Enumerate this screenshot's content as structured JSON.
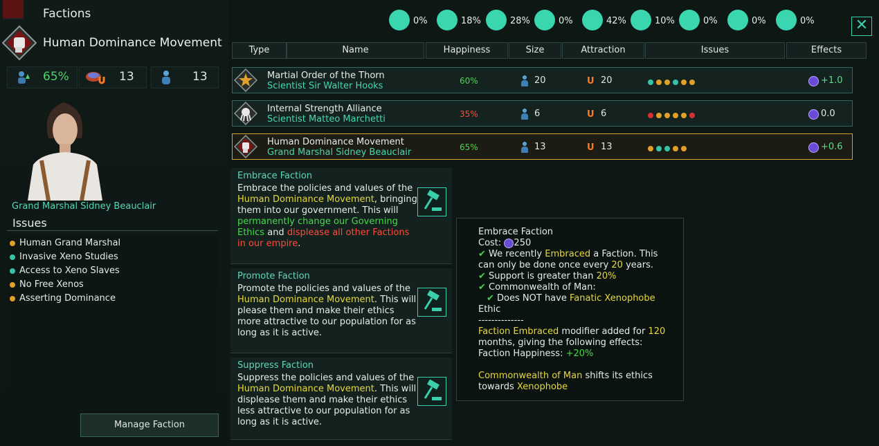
{
  "window": {
    "title": "Factions",
    "close_glyph": "✕"
  },
  "faction": {
    "name": "Human Dominance Movement",
    "happiness": "65%",
    "support": "13",
    "pops": "13",
    "leader": "Grand Marshal Sidney Beauclair"
  },
  "issues": {
    "title": "Issues",
    "items": [
      {
        "label": "Human Grand Marshal",
        "color": "#e0a029"
      },
      {
        "label": "Invasive Xeno Studies",
        "color": "#39c3a6"
      },
      {
        "label": "Access to Xeno Slaves",
        "color": "#39c3a6"
      },
      {
        "label": "No Free Xenos",
        "color": "#e0a029"
      },
      {
        "label": "Asserting Dominance",
        "color": "#e0a029"
      }
    ]
  },
  "manage_button": "Manage Faction",
  "ethics_stats": [
    {
      "icon": "ethic-xenophobe-icon",
      "pct": "0%"
    },
    {
      "icon": "ethic-egalitarian-icon",
      "pct": "18%"
    },
    {
      "icon": "ethic-materialist-icon",
      "pct": "28%"
    },
    {
      "icon": "ethic-spiritualist-icon",
      "pct": "0%"
    },
    {
      "icon": "ethic-militarist-icon",
      "pct": "42%"
    },
    {
      "icon": "ethic-pacifist-icon",
      "pct": "10%"
    },
    {
      "icon": "ethic-authoritarian-icon",
      "pct": "0%"
    },
    {
      "icon": "ethic-xenophile-icon",
      "pct": "0%"
    },
    {
      "icon": "ethic-gestalt-icon",
      "pct": "0%"
    }
  ],
  "table": {
    "headers": [
      "Type",
      "Name",
      "Happiness",
      "Size",
      "Attraction",
      "Issues",
      "Effects"
    ],
    "rows": [
      {
        "name": "Martial Order of the Thorn",
        "leader": "Scientist Sir Walter Hooks",
        "happiness": "60%",
        "happy_color": "#49d849",
        "size": "20",
        "attraction": "20",
        "effect": "+1.0",
        "effect_color": "#57e08b",
        "dots": [
          "#39c3a6",
          "#e0a029",
          "#e0a029",
          "#39c3a6",
          "#e0a029",
          "#e0a029"
        ]
      },
      {
        "name": "Internal Strength Alliance",
        "leader": "Scientist Matteo Marchetti",
        "happiness": "35%",
        "happy_color": "#ff4a3a",
        "size": "6",
        "attraction": "6",
        "effect": "0.0",
        "effect_color": "#e2e9e6",
        "dots": [
          "#d83030",
          "#e0a029",
          "#e0a029",
          "#e0a029",
          "#e0a029",
          "#d83030"
        ]
      },
      {
        "name": "Human Dominance Movement",
        "leader": "Grand Marshal Sidney Beauclair",
        "happiness": "65%",
        "happy_color": "#49d849",
        "size": "13",
        "attraction": "13",
        "effect": "+0.6",
        "effect_color": "#57e08b",
        "dots": [
          "#e0a029",
          "#39c3a6",
          "#39c3a6",
          "#e0a029",
          "#e0a029"
        ]
      }
    ]
  },
  "actions": {
    "embrace": {
      "title": "Embrace Faction",
      "p1": "Embrace the policies and values of the ",
      "p2": "Human Dominance Movement",
      "p3": ", bringing them into our government. This will ",
      "p4": "permanently change our Governing Ethics",
      "p5": " and ",
      "p6": "displease all other Factions in our empire",
      "p7": "."
    },
    "promote": {
      "title": "Promote Faction",
      "p1": "Promote the policies and values of the ",
      "p2": "Human Dominance Movement",
      "p3": ". This will please them and make their ethics more attractive to our population for as long as it is active."
    },
    "suppress": {
      "title": "Suppress Faction",
      "p1": "Suppress the policies and values of the ",
      "p2": "Human Dominance Movement",
      "p3": ". This will displease them and make their ethics less attractive to our population for as long as it is active."
    }
  },
  "tooltip": {
    "title": "Embrace Faction",
    "cost_label": "Cost:",
    "cost_value": "250",
    "l1a": "We recently ",
    "l1b": "Embraced",
    "l1c": " a Faction. This",
    "l2a": "can only be done once every ",
    "l2b": "20",
    "l2c": " years.",
    "l3a": "Support is greater than ",
    "l3b": "20%",
    "l4": "Commonwealth of Man:",
    "l5a": "Does NOT have ",
    "l5b": "Fanatic Xenophobe",
    "l6": "Ethic",
    "sep": "--------------",
    "l7a": "Faction Embraced",
    "l7b": " modifier added for ",
    "l7c": "120",
    "l8": "months, giving the following effects:",
    "l9a": "Faction Happiness: ",
    "l9b": "+20%",
    "l10a": "Commonwealth of Man",
    "l10b": " shifts its ethics",
    "l11a": "towards ",
    "l11b": "Xenophobe",
    "check": "✔"
  }
}
